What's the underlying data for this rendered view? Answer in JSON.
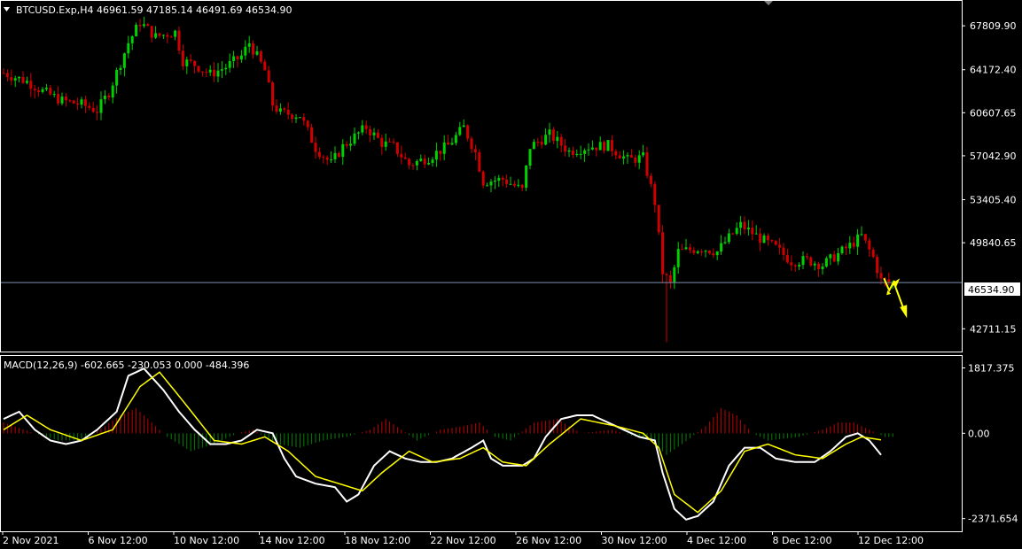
{
  "window": {
    "symbol_info": "BTCUSD.Exp,H4  46961.59 47185.14 46491.69 46534.90",
    "macd_info": "MACD(12,26,9) -602.665 -230.053 0.000 -484.396"
  },
  "colors": {
    "background": "#000000",
    "bull_candle": "#00d000",
    "bear_candle": "#d00000",
    "macd_line": "#ffffff",
    "signal_line": "#ffff00",
    "hist_up": "#c00000",
    "hist_down": "#008000",
    "price_line": "#8090b0",
    "arrow": "#ffff00",
    "frame": "#ffffff"
  },
  "chart_data": [
    {
      "type": "candlestick",
      "title": "BTCUSD.Exp,H4",
      "y_ticks": [
        "67809.90",
        "64172.40",
        "60607.65",
        "57042.90",
        "53405.40",
        "49840.65",
        "42711.15"
      ],
      "ylim": [
        40900,
        69800
      ],
      "current_price": "46534.90",
      "x_ticks": [
        "2 Nov 2021",
        "6 Nov 12:00",
        "10 Nov 12:00",
        "14 Nov 12:00",
        "18 Nov 12:00",
        "22 Nov 12:00",
        "26 Nov 12:00",
        "30 Nov 12:00",
        "4 Dec 12:00",
        "8 Dec 12:00",
        "12 Dec 12:00"
      ],
      "close_path": [
        [
          0,
          63900
        ],
        [
          6,
          63200
        ],
        [
          10,
          62400
        ],
        [
          15,
          61600
        ],
        [
          20,
          61300
        ],
        [
          24,
          60800
        ],
        [
          27,
          62300
        ],
        [
          32,
          66400
        ],
        [
          35,
          68100
        ],
        [
          39,
          66900
        ],
        [
          44,
          67300
        ],
        [
          46,
          64900
        ],
        [
          49,
          64600
        ],
        [
          53,
          63800
        ],
        [
          57,
          64400
        ],
        [
          61,
          65300
        ],
        [
          63,
          66400
        ],
        [
          67,
          64100
        ],
        [
          69,
          61300
        ],
        [
          71,
          60600
        ],
        [
          76,
          60400
        ],
        [
          80,
          57700
        ],
        [
          84,
          56400
        ],
        [
          87,
          57800
        ],
        [
          91,
          58900
        ],
        [
          93,
          59400
        ],
        [
          97,
          58100
        ],
        [
          100,
          57800
        ],
        [
          104,
          56300
        ],
        [
          109,
          56900
        ],
        [
          114,
          57900
        ],
        [
          118,
          59400
        ],
        [
          121,
          57300
        ],
        [
          123,
          54900
        ],
        [
          128,
          55100
        ],
        [
          133,
          54200
        ],
        [
          135,
          57800
        ],
        [
          140,
          58800
        ],
        [
          145,
          57400
        ],
        [
          150,
          57800
        ],
        [
          155,
          57900
        ],
        [
          160,
          56700
        ],
        [
          164,
          56900
        ],
        [
          167,
          53200
        ],
        [
          169,
          47400
        ],
        [
          171,
          46400
        ],
        [
          173,
          49100
        ],
        [
          179,
          49400
        ],
        [
          183,
          49100
        ],
        [
          185,
          49900
        ],
        [
          189,
          51300
        ],
        [
          194,
          50200
        ],
        [
          198,
          49400
        ],
        [
          202,
          48300
        ],
        [
          206,
          48400
        ],
        [
          210,
          48000
        ],
        [
          214,
          48900
        ],
        [
          217,
          49600
        ],
        [
          220,
          50400
        ],
        [
          223,
          48600
        ],
        [
          225,
          46700
        ],
        [
          228,
          46535
        ]
      ],
      "annotations": [
        "yellow arrows near last bar pointing down"
      ]
    },
    {
      "type": "macd",
      "title": "MACD(12,26,9)",
      "y_ticks": [
        "1817.375",
        "0.00",
        "-2371.654"
      ],
      "ylim": [
        -2700,
        2150
      ],
      "main_line": [
        [
          0,
          400
        ],
        [
          4,
          600
        ],
        [
          8,
          100
        ],
        [
          12,
          -200
        ],
        [
          16,
          -300
        ],
        [
          20,
          -200
        ],
        [
          24,
          100
        ],
        [
          29,
          600
        ],
        [
          32,
          1600
        ],
        [
          36,
          1800
        ],
        [
          41,
          1200
        ],
        [
          45,
          600
        ],
        [
          49,
          100
        ],
        [
          53,
          -300
        ],
        [
          57,
          -300
        ],
        [
          61,
          -200
        ],
        [
          65,
          100
        ],
        [
          69,
          0
        ],
        [
          72,
          -700
        ],
        [
          75,
          -1200
        ],
        [
          80,
          -1400
        ],
        [
          85,
          -1500
        ],
        [
          88,
          -1900
        ],
        [
          91,
          -1700
        ],
        [
          95,
          -900
        ],
        [
          99,
          -500
        ],
        [
          103,
          -700
        ],
        [
          107,
          -800
        ],
        [
          111,
          -800
        ],
        [
          115,
          -700
        ],
        [
          120,
          -400
        ],
        [
          123,
          -200
        ],
        [
          125,
          -700
        ],
        [
          128,
          -900
        ],
        [
          133,
          -900
        ],
        [
          136,
          -700
        ],
        [
          139,
          -100
        ],
        [
          143,
          400
        ],
        [
          147,
          500
        ],
        [
          151,
          500
        ],
        [
          155,
          300
        ],
        [
          159,
          100
        ],
        [
          163,
          -100
        ],
        [
          167,
          -200
        ],
        [
          169,
          -1100
        ],
        [
          172,
          -2100
        ],
        [
          175,
          -2400
        ],
        [
          178,
          -2300
        ],
        [
          182,
          -1900
        ],
        [
          186,
          -900
        ],
        [
          190,
          -400
        ],
        [
          194,
          -400
        ],
        [
          198,
          -700
        ],
        [
          203,
          -800
        ],
        [
          208,
          -800
        ],
        [
          212,
          -500
        ],
        [
          216,
          -100
        ],
        [
          219,
          0
        ],
        [
          222,
          -200
        ],
        [
          225,
          -600
        ]
      ],
      "signal_line": [
        [
          0,
          100
        ],
        [
          6,
          500
        ],
        [
          12,
          100
        ],
        [
          20,
          -200
        ],
        [
          28,
          100
        ],
        [
          35,
          1300
        ],
        [
          40,
          1700
        ],
        [
          46,
          900
        ],
        [
          54,
          -200
        ],
        [
          61,
          -300
        ],
        [
          67,
          -100
        ],
        [
          73,
          -500
        ],
        [
          80,
          -1200
        ],
        [
          86,
          -1400
        ],
        [
          92,
          -1600
        ],
        [
          97,
          -1100
        ],
        [
          104,
          -500
        ],
        [
          110,
          -800
        ],
        [
          117,
          -700
        ],
        [
          123,
          -400
        ],
        [
          128,
          -800
        ],
        [
          134,
          -900
        ],
        [
          140,
          -300
        ],
        [
          148,
          400
        ],
        [
          157,
          200
        ],
        [
          164,
          0
        ],
        [
          168,
          -400
        ],
        [
          172,
          -1700
        ],
        [
          178,
          -2200
        ],
        [
          184,
          -1600
        ],
        [
          190,
          -500
        ],
        [
          196,
          -300
        ],
        [
          203,
          -600
        ],
        [
          210,
          -700
        ],
        [
          216,
          -300
        ],
        [
          220,
          -100
        ],
        [
          226,
          -200
        ]
      ],
      "histogram": [
        [
          0,
          300
        ],
        [
          8,
          0
        ],
        [
          14,
          -200
        ],
        [
          20,
          -200
        ],
        [
          26,
          200
        ],
        [
          30,
          500
        ],
        [
          34,
          700
        ],
        [
          38,
          300
        ],
        [
          42,
          -100
        ],
        [
          48,
          -500
        ],
        [
          54,
          -300
        ],
        [
          60,
          0
        ],
        [
          64,
          100
        ],
        [
          70,
          -300
        ],
        [
          76,
          -400
        ],
        [
          82,
          -200
        ],
        [
          88,
          -100
        ],
        [
          94,
          100
        ],
        [
          98,
          400
        ],
        [
          102,
          100
        ],
        [
          106,
          -200
        ],
        [
          112,
          100
        ],
        [
          118,
          200
        ],
        [
          122,
          300
        ],
        [
          126,
          -100
        ],
        [
          130,
          -200
        ],
        [
          136,
          300
        ],
        [
          142,
          400
        ],
        [
          148,
          0
        ],
        [
          156,
          100
        ],
        [
          162,
          -100
        ],
        [
          166,
          -200
        ],
        [
          170,
          -600
        ],
        [
          174,
          -300
        ],
        [
          180,
          200
        ],
        [
          184,
          700
        ],
        [
          188,
          500
        ],
        [
          192,
          0
        ],
        [
          196,
          -200
        ],
        [
          204,
          -100
        ],
        [
          210,
          100
        ],
        [
          214,
          300
        ],
        [
          218,
          300
        ],
        [
          222,
          100
        ],
        [
          226,
          -100
        ]
      ]
    }
  ]
}
